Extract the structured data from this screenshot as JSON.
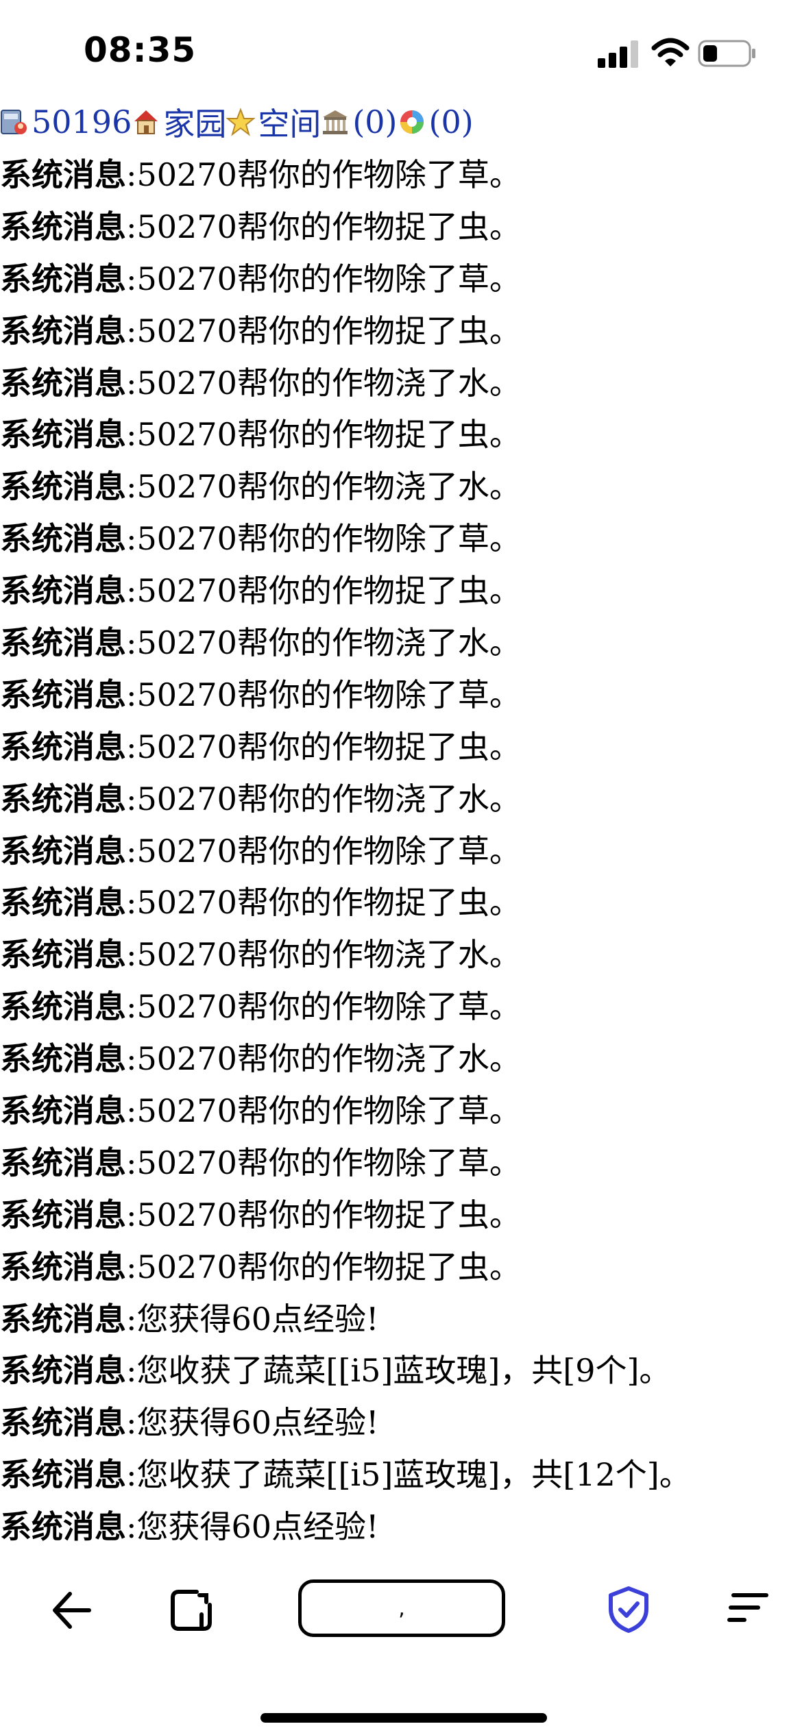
{
  "status_bar": {
    "time": "08:35"
  },
  "topnav": {
    "user_id": "50196",
    "home_label": "家园",
    "space_label": "空间",
    "count1": "(0)",
    "count2": "(0)"
  },
  "messages": [
    {
      "label": "系统消息",
      "text": ":50270帮你的作物除了草。"
    },
    {
      "label": "系统消息",
      "text": ":50270帮你的作物捉了虫。"
    },
    {
      "label": "系统消息",
      "text": ":50270帮你的作物除了草。"
    },
    {
      "label": "系统消息",
      "text": ":50270帮你的作物捉了虫。"
    },
    {
      "label": "系统消息",
      "text": ":50270帮你的作物浇了水。"
    },
    {
      "label": "系统消息",
      "text": ":50270帮你的作物捉了虫。"
    },
    {
      "label": "系统消息",
      "text": ":50270帮你的作物浇了水。"
    },
    {
      "label": "系统消息",
      "text": ":50270帮你的作物除了草。"
    },
    {
      "label": "系统消息",
      "text": ":50270帮你的作物捉了虫。"
    },
    {
      "label": "系统消息",
      "text": ":50270帮你的作物浇了水。"
    },
    {
      "label": "系统消息",
      "text": ":50270帮你的作物除了草。"
    },
    {
      "label": "系统消息",
      "text": ":50270帮你的作物捉了虫。"
    },
    {
      "label": "系统消息",
      "text": ":50270帮你的作物浇了水。"
    },
    {
      "label": "系统消息",
      "text": ":50270帮你的作物除了草。"
    },
    {
      "label": "系统消息",
      "text": ":50270帮你的作物捉了虫。"
    },
    {
      "label": "系统消息",
      "text": ":50270帮你的作物浇了水。"
    },
    {
      "label": "系统消息",
      "text": ":50270帮你的作物除了草。"
    },
    {
      "label": "系统消息",
      "text": ":50270帮你的作物浇了水。"
    },
    {
      "label": "系统消息",
      "text": ":50270帮你的作物除了草。"
    },
    {
      "label": "系统消息",
      "text": ":50270帮你的作物除了草。"
    },
    {
      "label": "系统消息",
      "text": ":50270帮你的作物捉了虫。"
    },
    {
      "label": "系统消息",
      "text": ":50270帮你的作物捉了虫。"
    },
    {
      "label": "系统消息",
      "text": ":您获得60点经验!"
    },
    {
      "label": "系统消息",
      "text": ":您收获了蔬菜[[i5]蓝玫瑰]，共[9个]。"
    },
    {
      "label": "系统消息",
      "text": ":您获得60点经验!"
    },
    {
      "label": "系统消息",
      "text": ":您收获了蔬菜[[i5]蓝玫瑰]，共[12个]。"
    },
    {
      "label": "系统消息",
      "text": ":您获得60点经验!"
    }
  ],
  "toolbar": {
    "address_text": ","
  },
  "colors": {
    "link": "#1a35a8",
    "shield_accent": "#3a40d8"
  },
  "icons": [
    "back-arrow-icon",
    "tabs-icon",
    "shield-check-icon",
    "menu-icon"
  ]
}
